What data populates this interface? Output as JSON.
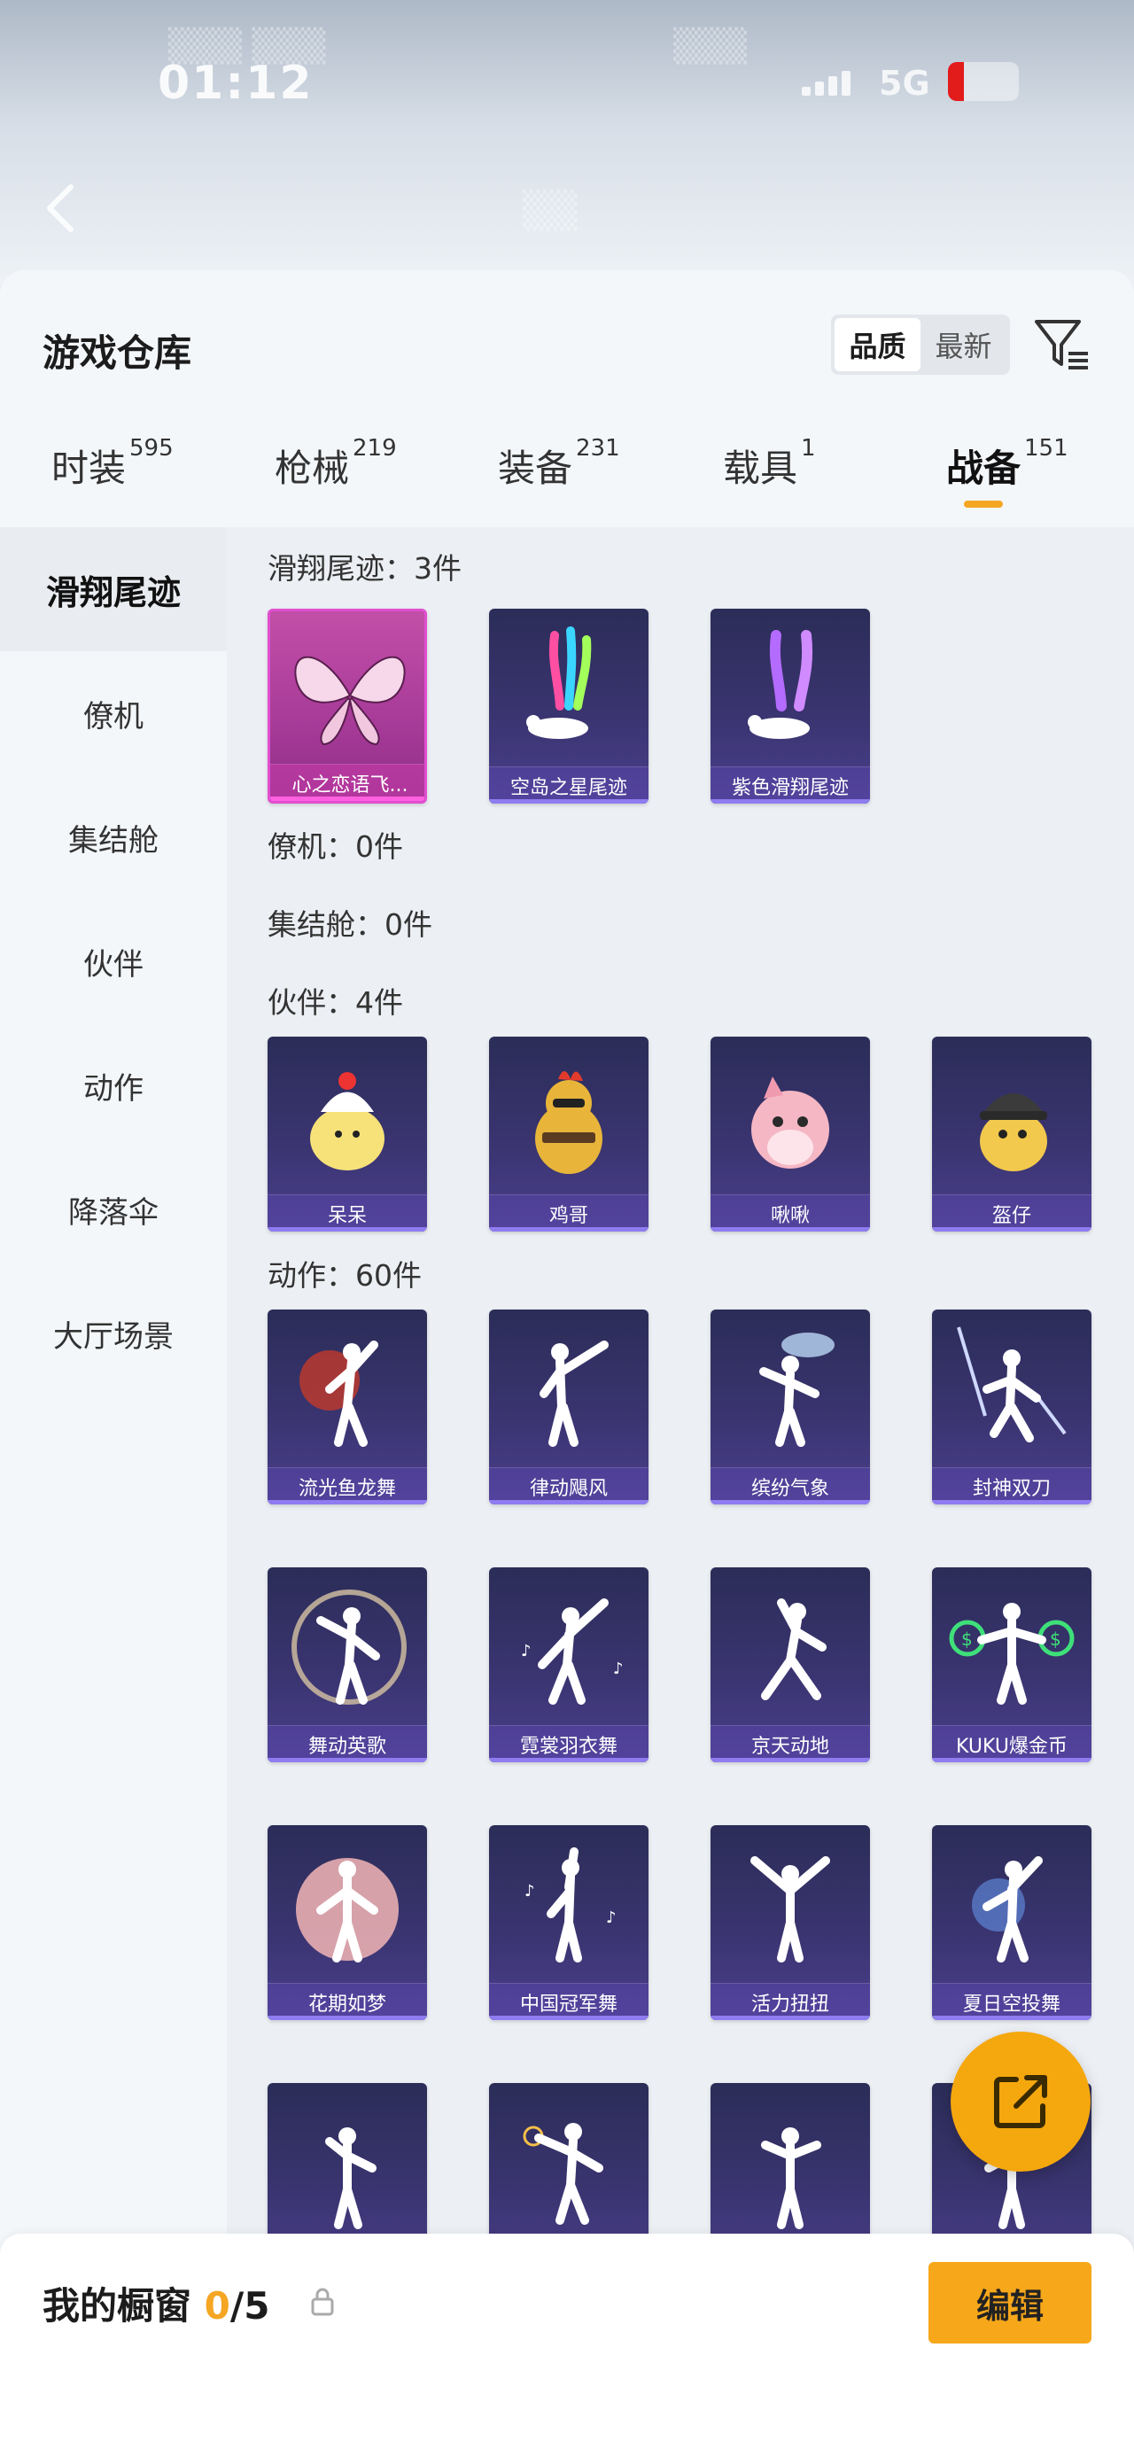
{
  "status_bar": {
    "time": "01:12",
    "network": "5G",
    "battery_color": "#e21b1b"
  },
  "header": {
    "title": "游戏仓库",
    "sort_options": [
      "品质",
      "最新"
    ],
    "sort_selected": "品质"
  },
  "tabs": [
    {
      "label": "时装",
      "count": "595"
    },
    {
      "label": "枪械",
      "count": "219"
    },
    {
      "label": "装备",
      "count": "231"
    },
    {
      "label": "载具",
      "count": "1"
    },
    {
      "label": "战备",
      "count": "151",
      "active": true
    }
  ],
  "sidebar": {
    "items": [
      {
        "label": "滑翔尾迹",
        "active": true
      },
      {
        "label": "僚机"
      },
      {
        "label": "集结舱"
      },
      {
        "label": "伙伴"
      },
      {
        "label": "动作"
      },
      {
        "label": "降落伞"
      },
      {
        "label": "大厅场景"
      }
    ]
  },
  "sections": {
    "glide": {
      "title": "滑翔尾迹：3件",
      "items": [
        "心之恋语飞...",
        "空岛之星尾迹",
        "紫色滑翔尾迹"
      ]
    },
    "wingman": {
      "title": "僚机：0件"
    },
    "pod": {
      "title": "集结舱：0件"
    },
    "partner": {
      "title": "伙伴：4件",
      "items": [
        "呆呆",
        "鸡哥",
        "啾啾",
        "盔仔"
      ]
    },
    "emote": {
      "title": "动作：60件",
      "items": [
        "流光鱼龙舞",
        "律动飓风",
        "缤纷气象",
        "封神双刀",
        "舞动英歌",
        "霓裳羽衣舞",
        "京天动地",
        "KUKU爆金币",
        "花期如梦",
        "中国冠军舞",
        "活力扭扭",
        "夏日空投舞",
        "",
        "",
        "",
        ""
      ]
    }
  },
  "bottom": {
    "showcase_label": "我的橱窗 ",
    "showcase_current": "0",
    "showcase_total": "/5",
    "edit_label": "编辑"
  },
  "colors": {
    "accent": "#f5a623",
    "card_purple": "#3a3470",
    "card_pink": "#c24fa8"
  }
}
